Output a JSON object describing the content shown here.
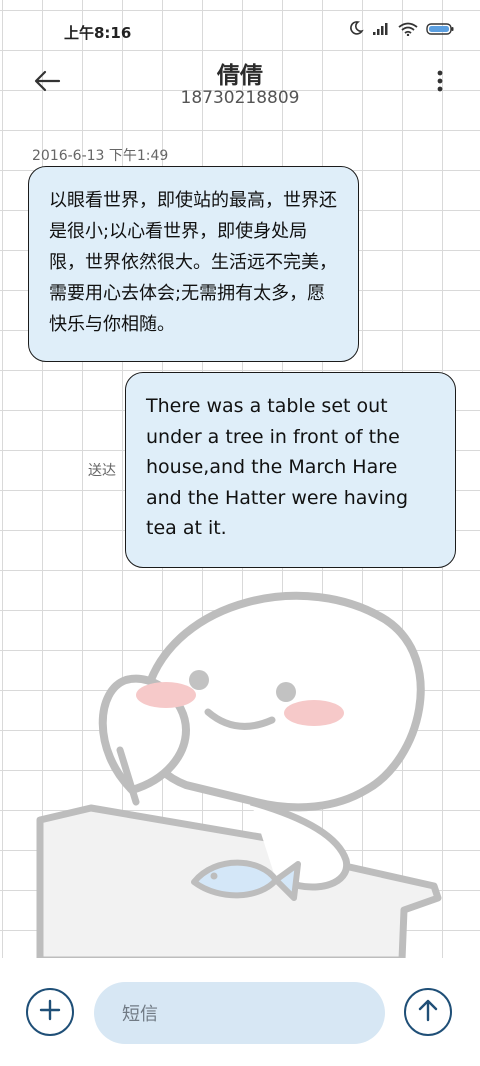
{
  "status_bar": {
    "time": "上午8:16",
    "icons": [
      "moon-icon",
      "signal-icon",
      "wifi-icon",
      "battery-icon"
    ]
  },
  "header": {
    "contact_name": "倩倩",
    "contact_number": "18730218809",
    "back_icon": "arrow-left-icon",
    "more_icon": "more-vertical-icon"
  },
  "conversation": {
    "timestamp": "2016-6-13 下午1:49",
    "incoming_message": "以眼看世界，即使站的最高，世界还是很小;以心看世界，即使身处局限，世界依然很大。生活远不完美，需要用心去体会;无需拥有太多，愿快乐与你相随。",
    "outgoing_message": "There was a table set out under a tree in front of the house,and the March Hare and the Hatter were having tea at it.",
    "delivery_status": "送达"
  },
  "input_bar": {
    "placeholder": "短信",
    "add_icon": "plus-icon",
    "send_icon": "arrow-up-icon"
  },
  "colors": {
    "bubble_fill": "#dfeef9",
    "bubble_border": "#1b1b1b",
    "input_fill": "#d7e7f4",
    "button_stroke": "#1f4f77",
    "grid_line": "#d9d9d9"
  }
}
